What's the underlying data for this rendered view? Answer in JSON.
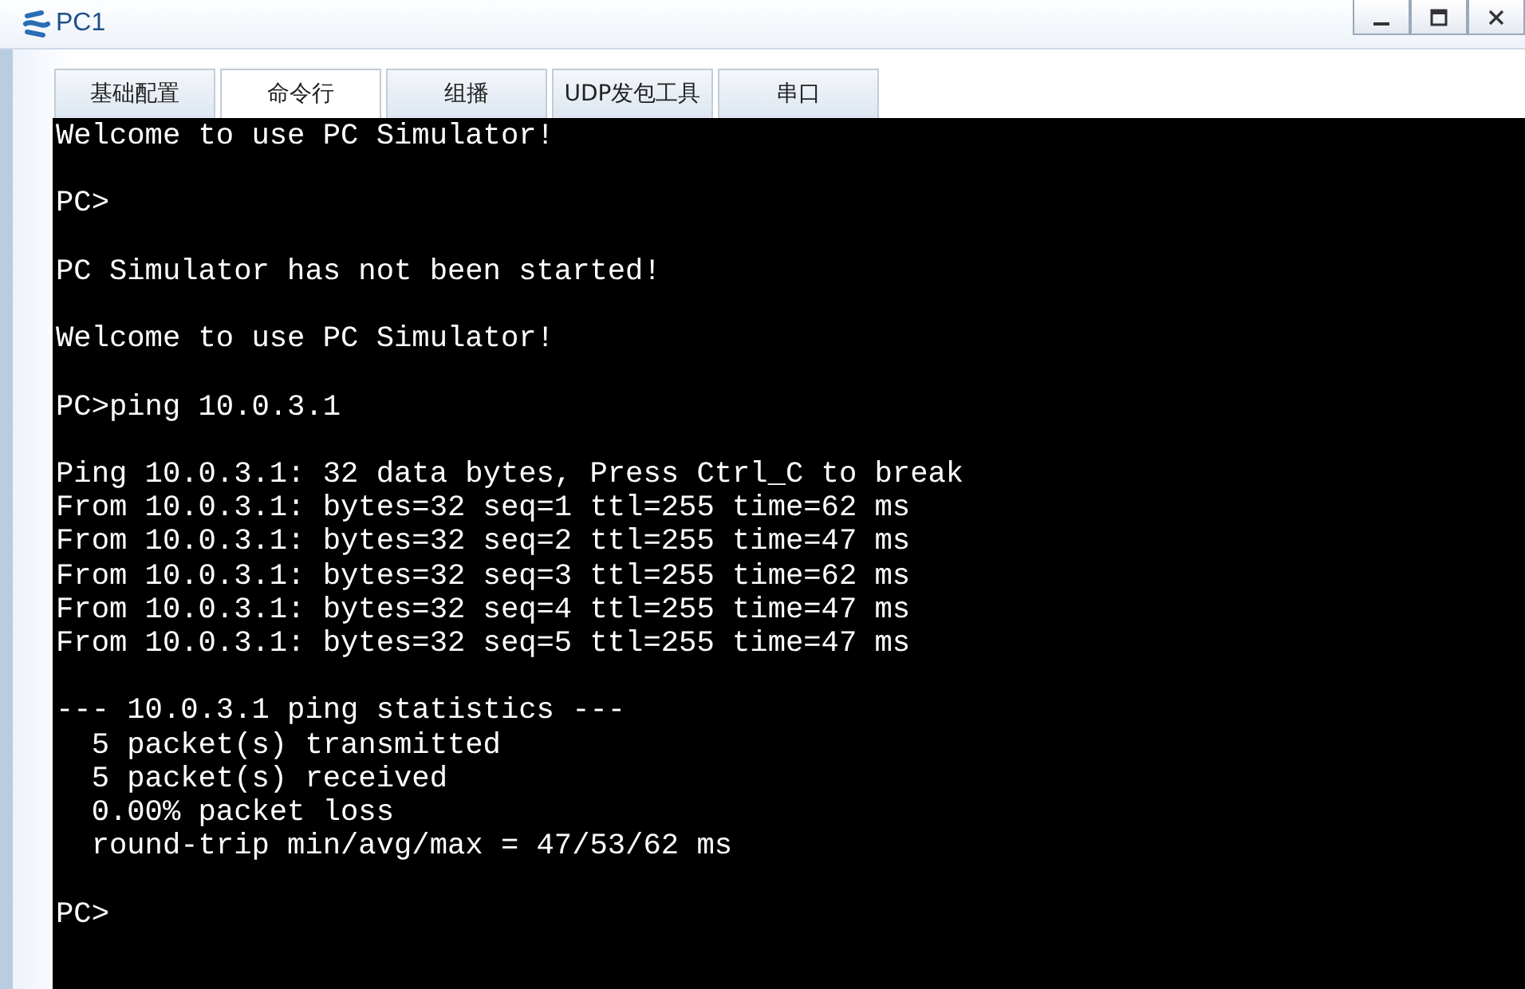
{
  "window": {
    "title": "PC1"
  },
  "tabs": [
    {
      "label": "基础配置",
      "selected": false
    },
    {
      "label": "命令行",
      "selected": true
    },
    {
      "label": "组播",
      "selected": false
    },
    {
      "label": "UDP发包工具",
      "selected": false
    },
    {
      "label": "串口",
      "selected": false
    }
  ],
  "terminal": {
    "blocks": [
      [
        "Welcome to use PC Simulator!"
      ],
      [
        "PC>"
      ],
      [
        "PC Simulator has not been started!"
      ],
      [
        "Welcome to use PC Simulator!"
      ],
      [
        "PC>ping 10.0.3.1"
      ],
      [
        "Ping 10.0.3.1: 32 data bytes, Press Ctrl_C to break",
        "From 10.0.3.1: bytes=32 seq=1 ttl=255 time=62 ms",
        "From 10.0.3.1: bytes=32 seq=2 ttl=255 time=47 ms",
        "From 10.0.3.1: bytes=32 seq=3 ttl=255 time=62 ms",
        "From 10.0.3.1: bytes=32 seq=4 ttl=255 time=47 ms",
        "From 10.0.3.1: bytes=32 seq=5 ttl=255 time=47 ms"
      ],
      [
        "--- 10.0.3.1 ping statistics ---",
        "  5 packet(s) transmitted",
        "  5 packet(s) received",
        "  0.00% packet loss",
        "  round-trip min/avg/max = 47/53/62 ms"
      ],
      [
        "PC>"
      ]
    ]
  }
}
